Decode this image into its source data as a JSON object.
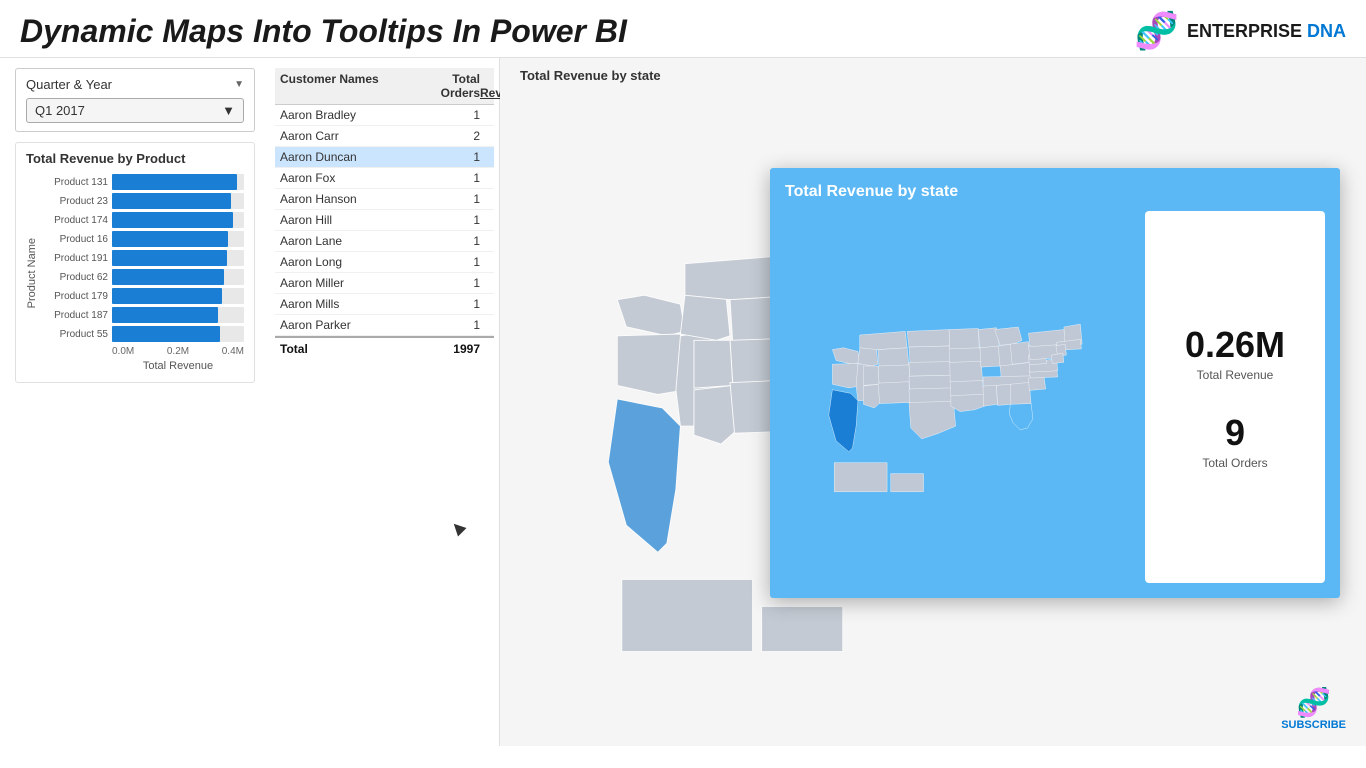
{
  "header": {
    "title": "Dynamic Maps Into Tooltips In Power BI",
    "logo_text": "ENTERPRISE DNA",
    "logo_dna_icon": "🧬"
  },
  "slicer": {
    "label": "Quarter & Year",
    "value": "Q1 2017",
    "chevron": "▼"
  },
  "table": {
    "headers": [
      "Customer Names",
      "Total Orders",
      "Total Revenue"
    ],
    "rows": [
      {
        "name": "Aaron Bradley",
        "orders": "1",
        "revenue": ""
      },
      {
        "name": "Aaron Carr",
        "orders": "2",
        "revenue": ""
      },
      {
        "name": "Aaron Duncan",
        "orders": "1",
        "revenue": ""
      },
      {
        "name": "Aaron Fox",
        "orders": "1",
        "revenue": ""
      },
      {
        "name": "Aaron Hanson",
        "orders": "1",
        "revenue": ""
      },
      {
        "name": "Aaron Hill",
        "orders": "1",
        "revenue": ""
      },
      {
        "name": "Aaron Lane",
        "orders": "1",
        "revenue": ""
      },
      {
        "name": "Aaron Long",
        "orders": "1",
        "revenue": ""
      },
      {
        "name": "Aaron Miller",
        "orders": "1",
        "revenue": ""
      },
      {
        "name": "Aaron Mills",
        "orders": "1",
        "revenue": ""
      },
      {
        "name": "Aaron Parker",
        "orders": "1",
        "revenue": ""
      }
    ],
    "total_label": "Total",
    "total_orders": "1997",
    "revenue_col_header_underline": true
  },
  "bar_chart": {
    "title": "Total Revenue by Product",
    "y_axis_label": "Product Name",
    "x_axis_label": "Total Revenue",
    "x_ticks": [
      "0.0M",
      "0.2M",
      "0.4M"
    ],
    "bars": [
      {
        "label": "Product 131",
        "pct": 95
      },
      {
        "label": "Product 23",
        "pct": 90
      },
      {
        "label": "Product 174",
        "pct": 92
      },
      {
        "label": "Product 16",
        "pct": 88
      },
      {
        "label": "Product 191",
        "pct": 87
      },
      {
        "label": "Product 62",
        "pct": 85
      },
      {
        "label": "Product 179",
        "pct": 83
      },
      {
        "label": "Product 187",
        "pct": 80
      },
      {
        "label": "Product 55",
        "pct": 82
      }
    ]
  },
  "map": {
    "title": "Total Revenue by state"
  },
  "tooltip": {
    "title": "Total Revenue by state",
    "stat1_value": "0.26M",
    "stat1_label": "Total Revenue",
    "stat2_value": "9",
    "stat2_label": "Total Orders"
  },
  "subscribe": {
    "icon": "🧬",
    "label": "SUBSCRIBE"
  }
}
